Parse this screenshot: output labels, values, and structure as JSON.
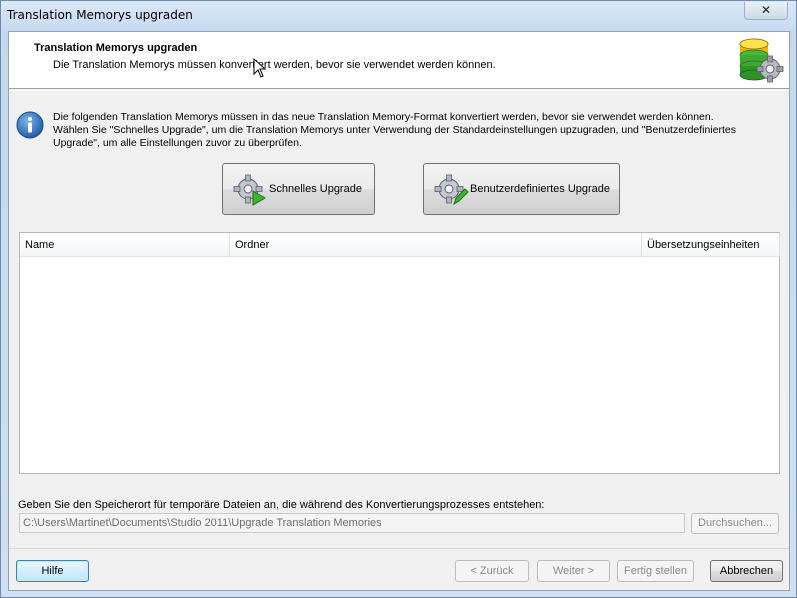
{
  "window": {
    "title": "Translation Memorys upgraden",
    "close_glyph": "✕"
  },
  "header": {
    "title": "Translation Memorys upgraden",
    "subtitle": "Die Translation Memorys müssen konvertiert werden, bevor sie verwendet werden können.",
    "icon": "database-gear-icon"
  },
  "info": {
    "icon": "info-icon",
    "text": "Die folgenden Translation Memorys müssen in das neue Translation Memory-Format konvertiert werden, bevor sie verwendet werden können. Wählen Sie \"Schnelles Upgrade\", um die Translation Memorys unter Verwendung der Standardeinstellungen upzugraden, und \"Benutzerdefiniertes Upgrade\", um alle Einstellungen zuvor zu überprüfen."
  },
  "actions": {
    "quick_upgrade_label": "Schnelles Upgrade",
    "custom_upgrade_label": "Benutzerdefiniertes Upgrade"
  },
  "table": {
    "columns": [
      "Name",
      "Ordner",
      "Übersetzungseinheiten"
    ],
    "rows": []
  },
  "temp_path": {
    "label": "Geben Sie den Speicherort für temporäre Dateien an, die während des Konvertierungsprozesses entstehen:",
    "value": "C:\\Users\\Martinet\\Documents\\Studio 2011\\Upgrade Translation Memories",
    "browse_label": "Durchsuchen..."
  },
  "footer": {
    "help_label": "Hilfe",
    "back_label": "< Zurück",
    "next_label": "Weiter >",
    "finish_label": "Fertig stellen",
    "cancel_label": "Abbrechen"
  },
  "colors": {
    "accent": "#3c7fb1",
    "info_blue": "#1f5fa8"
  }
}
